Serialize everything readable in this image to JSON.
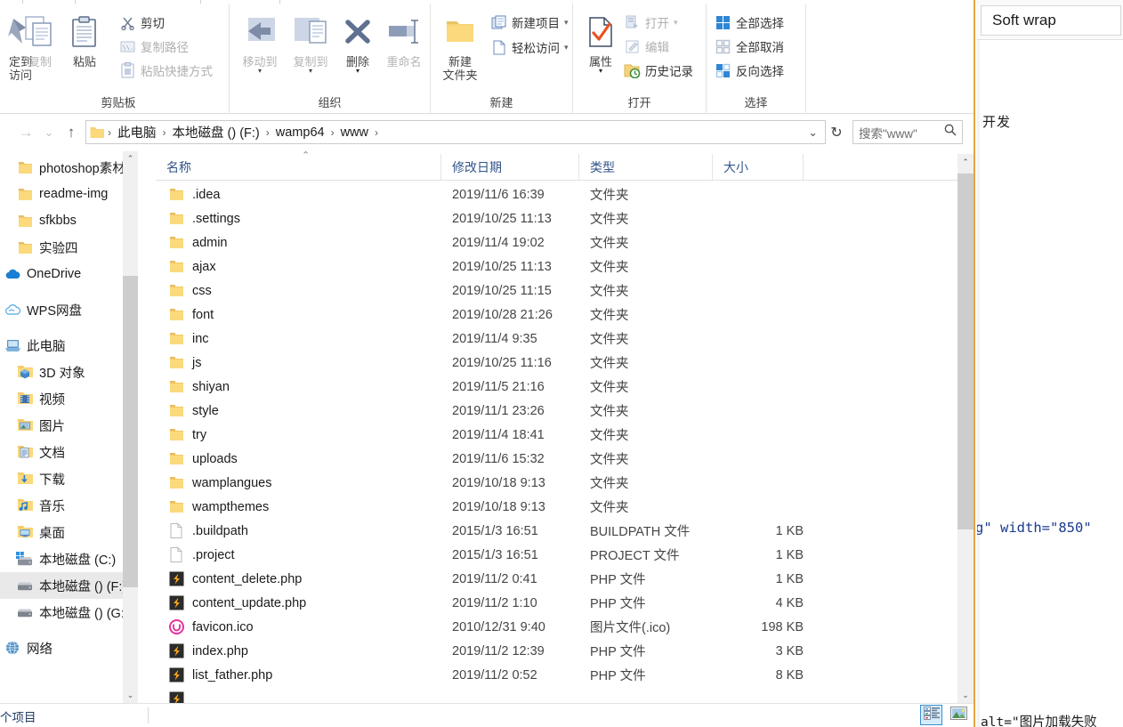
{
  "window": {
    "type": "windows-file-explorer",
    "accent_color": "#e8a33d",
    "selection_blue": "#3a8fd4"
  },
  "ribbon": {
    "groups": [
      {
        "label": "剪贴板",
        "big_buttons": [
          {
            "name": "pin-to-quick-access",
            "line1": "定到",
            "line2": "访问",
            "icon": "pin-icon",
            "disabled": false
          },
          {
            "name": "copy",
            "line1": "复制",
            "line2": "",
            "icon": "copy-icon",
            "disabled": true
          },
          {
            "name": "paste",
            "line1": "粘贴",
            "line2": "",
            "icon": "clipboard-icon",
            "disabled": false
          }
        ],
        "small_buttons": [
          {
            "name": "cut",
            "label": "剪切",
            "icon": "scissors-icon",
            "disabled": false
          },
          {
            "name": "copy-path",
            "label": "复制路径",
            "icon": "copy-path-icon",
            "disabled": true
          },
          {
            "name": "paste-shortcut",
            "label": "粘贴快捷方式",
            "icon": "paste-shortcut-icon",
            "disabled": true
          }
        ]
      },
      {
        "label": "组织",
        "big_buttons": [
          {
            "name": "move-to",
            "line1": "移动到",
            "line2": "",
            "icon": "move-to-icon",
            "disabled": true,
            "has_caret": true
          },
          {
            "name": "copy-to",
            "line1": "复制到",
            "line2": "",
            "icon": "copy-to-icon",
            "disabled": true,
            "has_caret": true
          },
          {
            "name": "delete",
            "line1": "删除",
            "line2": "",
            "icon": "delete-x-icon",
            "disabled": false,
            "has_caret": true
          },
          {
            "name": "rename",
            "line1": "重命名",
            "line2": "",
            "icon": "rename-icon",
            "disabled": true
          }
        ]
      },
      {
        "label": "新建",
        "big_buttons": [
          {
            "name": "new-folder",
            "line1": "新建",
            "line2": "文件夹",
            "icon": "folder-icon",
            "disabled": false
          }
        ],
        "small_buttons": [
          {
            "name": "new-item",
            "label": "新建项目",
            "icon": "new-item-icon",
            "has_caret": true
          },
          {
            "name": "easy-access",
            "label": "轻松访问",
            "icon": "easy-access-icon",
            "has_caret": true
          }
        ]
      },
      {
        "label": "打开",
        "big_buttons": [
          {
            "name": "properties",
            "line1": "属性",
            "line2": "",
            "icon": "properties-icon",
            "disabled": false,
            "has_caret": true
          }
        ],
        "small_buttons": [
          {
            "name": "open",
            "label": "打开",
            "icon": "open-icon",
            "disabled": true,
            "has_caret": true
          },
          {
            "name": "edit",
            "label": "编辑",
            "icon": "edit-pencil-icon",
            "disabled": true
          },
          {
            "name": "history",
            "label": "历史记录",
            "icon": "history-icon",
            "disabled": false
          }
        ]
      },
      {
        "label": "选择",
        "small_buttons": [
          {
            "name": "select-all",
            "label": "全部选择",
            "icon": "select-all-icon"
          },
          {
            "name": "select-none",
            "label": "全部取消",
            "icon": "select-none-icon"
          },
          {
            "name": "invert-selection",
            "label": "反向选择",
            "icon": "invert-selection-icon"
          }
        ]
      }
    ]
  },
  "address_bar": {
    "back": "←",
    "forward": "→",
    "recent": "⌄",
    "up": "↑",
    "breadcrumbs": [
      "此电脑",
      "本地磁盘 ()  (F:)",
      "wamp64",
      "www"
    ],
    "separator": "›",
    "dropdown_chevron": "⌄",
    "refresh": "↻",
    "search_placeholder": "搜索\"www\"",
    "search_value": "",
    "search_icon": "search-icon"
  },
  "sidebar": {
    "items": [
      {
        "name": "photoshop-materials",
        "label": "photoshop素材",
        "icon": "folder-icon",
        "indent": 18,
        "selected": false
      },
      {
        "name": "readme-img",
        "label": "readme-img",
        "icon": "folder-icon",
        "indent": 18,
        "selected": false
      },
      {
        "name": "sfkbbs",
        "label": "sfkbbs",
        "icon": "folder-icon",
        "indent": 18,
        "selected": false
      },
      {
        "name": "experiment-four",
        "label": "实验四",
        "icon": "folder-icon",
        "indent": 18,
        "selected": false
      },
      {
        "name": "onedrive",
        "label": "OneDrive",
        "icon": "onedrive-cloud-icon",
        "indent": 4,
        "selected": false
      },
      {
        "name": "wps-cloud",
        "label": "WPS网盘",
        "icon": "wps-cloud-icon",
        "indent": 4,
        "selected": false
      },
      {
        "name": "this-pc",
        "label": "此电脑",
        "icon": "this-pc-icon",
        "indent": 4,
        "selected": false
      },
      {
        "name": "3d-objects",
        "label": "3D 对象",
        "icon": "3d-objects-icon",
        "indent": 18,
        "selected": false
      },
      {
        "name": "videos",
        "label": "视频",
        "icon": "videos-icon",
        "indent": 18,
        "selected": false
      },
      {
        "name": "pictures",
        "label": "图片",
        "icon": "pictures-icon",
        "indent": 18,
        "selected": false
      },
      {
        "name": "documents",
        "label": "文档",
        "icon": "documents-icon",
        "indent": 18,
        "selected": false
      },
      {
        "name": "downloads",
        "label": "下载",
        "icon": "downloads-icon",
        "indent": 18,
        "selected": false
      },
      {
        "name": "music",
        "label": "音乐",
        "icon": "music-icon",
        "indent": 18,
        "selected": false
      },
      {
        "name": "desktop",
        "label": "桌面",
        "icon": "desktop-icon",
        "indent": 18,
        "selected": false
      },
      {
        "name": "local-disk-c",
        "label": "本地磁盘 (C:)",
        "icon": "windows-disk-icon",
        "indent": 18,
        "selected": false
      },
      {
        "name": "local-disk-f",
        "label": "本地磁盘 ()  (F:)",
        "icon": "disk-icon",
        "indent": 18,
        "selected": true
      },
      {
        "name": "local-disk-g",
        "label": "本地磁盘 ()  (G:)",
        "icon": "disk-icon",
        "indent": 18,
        "selected": false
      },
      {
        "name": "network",
        "label": "网络",
        "icon": "network-icon",
        "indent": 4,
        "selected": false
      }
    ],
    "scroll_up": "⌃",
    "scroll_down": "⌄"
  },
  "file_list": {
    "columns": [
      {
        "name": "name",
        "label": "名称",
        "sorted": true,
        "sort_dir": "asc"
      },
      {
        "name": "date-modified",
        "label": "修改日期"
      },
      {
        "name": "type",
        "label": "类型"
      },
      {
        "name": "size",
        "label": "大小"
      }
    ],
    "sort_indicator": "⌃",
    "rows": [
      {
        "name": ".idea",
        "date": "2019/11/6 16:39",
        "type": "文件夹",
        "size": "",
        "icon": "folder-icon"
      },
      {
        "name": ".settings",
        "date": "2019/10/25 11:13",
        "type": "文件夹",
        "size": "",
        "icon": "folder-icon"
      },
      {
        "name": "admin",
        "date": "2019/11/4 19:02",
        "type": "文件夹",
        "size": "",
        "icon": "folder-icon"
      },
      {
        "name": "ajax",
        "date": "2019/10/25 11:13",
        "type": "文件夹",
        "size": "",
        "icon": "folder-icon"
      },
      {
        "name": "css",
        "date": "2019/10/25 11:15",
        "type": "文件夹",
        "size": "",
        "icon": "folder-icon"
      },
      {
        "name": "font",
        "date": "2019/10/28 21:26",
        "type": "文件夹",
        "size": "",
        "icon": "folder-icon"
      },
      {
        "name": "inc",
        "date": "2019/11/4 9:35",
        "type": "文件夹",
        "size": "",
        "icon": "folder-icon"
      },
      {
        "name": "js",
        "date": "2019/10/25 11:16",
        "type": "文件夹",
        "size": "",
        "icon": "folder-icon"
      },
      {
        "name": "shiyan",
        "date": "2019/11/5 21:16",
        "type": "文件夹",
        "size": "",
        "icon": "folder-icon"
      },
      {
        "name": "style",
        "date": "2019/11/1 23:26",
        "type": "文件夹",
        "size": "",
        "icon": "folder-icon"
      },
      {
        "name": "try",
        "date": "2019/11/4 18:41",
        "type": "文件夹",
        "size": "",
        "icon": "folder-icon"
      },
      {
        "name": "uploads",
        "date": "2019/11/6 15:32",
        "type": "文件夹",
        "size": "",
        "icon": "folder-icon"
      },
      {
        "name": "wamplangues",
        "date": "2019/10/18 9:13",
        "type": "文件夹",
        "size": "",
        "icon": "folder-icon"
      },
      {
        "name": "wampthemes",
        "date": "2019/10/18 9:13",
        "type": "文件夹",
        "size": "",
        "icon": "folder-icon"
      },
      {
        "name": ".buildpath",
        "date": "2015/1/3 16:51",
        "type": "BUILDPATH 文件",
        "size": "1 KB",
        "icon": "blank-file-icon"
      },
      {
        "name": ".project",
        "date": "2015/1/3 16:51",
        "type": "PROJECT 文件",
        "size": "1 KB",
        "icon": "blank-file-icon"
      },
      {
        "name": "content_delete.php",
        "date": "2019/11/2 0:41",
        "type": "PHP 文件",
        "size": "1 KB",
        "icon": "php-file-icon"
      },
      {
        "name": "content_update.php",
        "date": "2019/11/2 1:10",
        "type": "PHP 文件",
        "size": "4 KB",
        "icon": "php-file-icon"
      },
      {
        "name": "favicon.ico",
        "date": "2010/12/31 9:40",
        "type": "图片文件(.ico)",
        "size": "198 KB",
        "icon": "ico-file-icon"
      },
      {
        "name": "index.php",
        "date": "2019/11/2 12:39",
        "type": "PHP 文件",
        "size": "3 KB",
        "icon": "php-file-icon"
      },
      {
        "name": "list_father.php",
        "date": "2019/11/2 0:52",
        "type": "PHP 文件",
        "size": "8 KB",
        "icon": "php-file-icon"
      }
    ],
    "scroll_up": "⌃",
    "scroll_down": "⌄"
  },
  "status_bar": {
    "item_count_text": "个项目",
    "view_buttons": [
      {
        "name": "details-view-button",
        "icon": "details-view-icon",
        "active": true
      },
      {
        "name": "large-icons-view-button",
        "icon": "large-icons-view-icon",
        "active": false
      }
    ]
  },
  "editor_panel": {
    "toolbar": {
      "soft_wrap_label": "Soft wrap"
    },
    "lines": [
      {
        "text": "开发",
        "style": "cn"
      },
      {
        "text": "g\" width=\"850\"",
        "style": "code"
      },
      {
        "text": "alt=\"图片加载失败",
        "style": "code2"
      }
    ]
  }
}
